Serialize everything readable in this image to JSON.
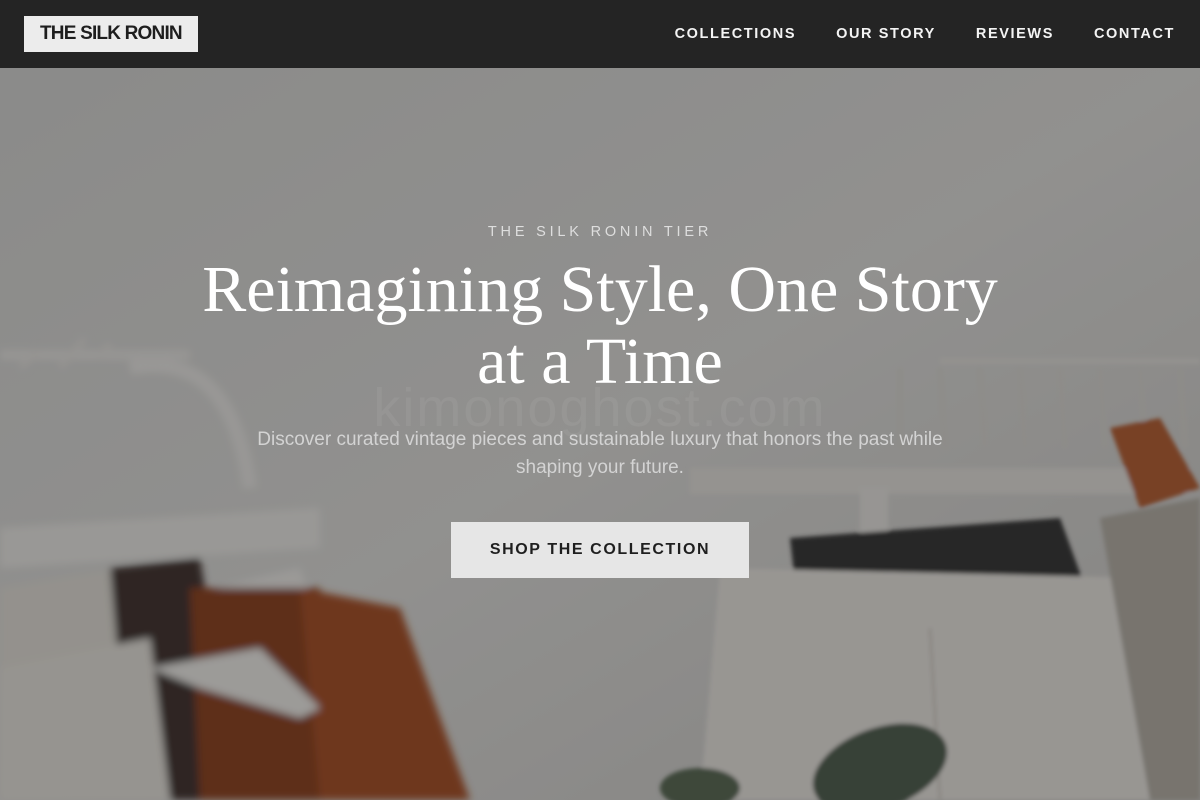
{
  "brand": {
    "logo_text": "THE SILK RONIN"
  },
  "nav": {
    "items": [
      {
        "label": "COLLECTIONS"
      },
      {
        "label": "OUR STORY"
      },
      {
        "label": "REVIEWS"
      },
      {
        "label": "CONTACT"
      }
    ]
  },
  "hero": {
    "eyebrow": "THE SILK RONIN TIER",
    "headline": "Reimagining Style, One Story at a Time",
    "watermark": "kimonoghost.com",
    "subtext": "Discover curated vintage pieces and sustainable luxury that honors the past while shaping your future.",
    "cta_label": "SHOP THE COLLECTION",
    "background_image": "clothing-racks-photo"
  },
  "colors": {
    "navbar_bg": "#242424",
    "logo_bg": "#ececec",
    "cta_bg": "#e6e6e6",
    "text_light": "#ffffff",
    "accent_rust": "#a8491f"
  }
}
